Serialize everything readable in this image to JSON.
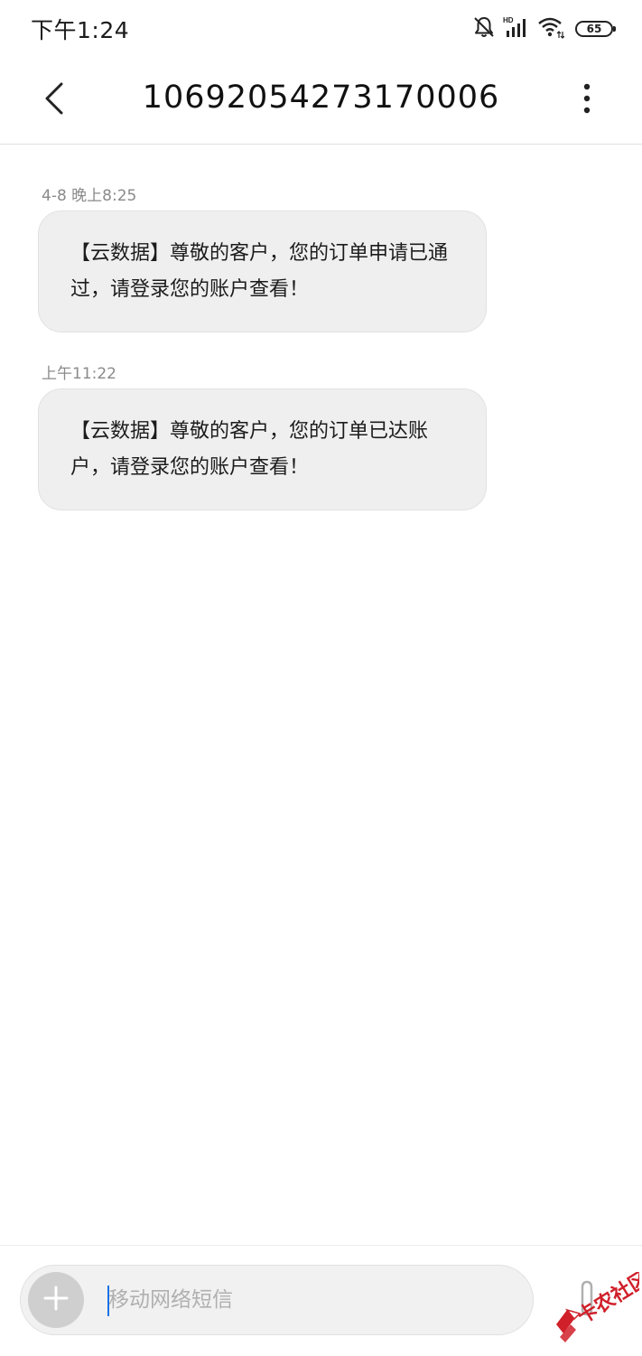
{
  "status_bar": {
    "time": "下午1:24",
    "battery_level": "65",
    "icons": [
      "bell-muted-icon",
      "hd-signal-icon",
      "wifi-icon",
      "battery-icon"
    ]
  },
  "header": {
    "title": "10692054273170006",
    "back_icon": "chevron-left-icon",
    "more_icon": "more-vertical-icon"
  },
  "messages": [
    {
      "time": "4-8 晚上8:25",
      "text": "【云数据】尊敬的客户，您的订单申请已通过，请登录您的账户查看！"
    },
    {
      "time": "上午11:22",
      "text": "【云数据】尊敬的客户，您的订单已达账户，请登录您的账户查看！"
    }
  ],
  "composer": {
    "placeholder": "移动网络短信",
    "add_icon": "plus-icon",
    "attach_icon": "paperclip-icon"
  },
  "watermark": {
    "text": "卡农社区"
  },
  "colors": {
    "bubble": "#efefef",
    "caret": "#1a73e8",
    "watermark": "#d0202a"
  }
}
